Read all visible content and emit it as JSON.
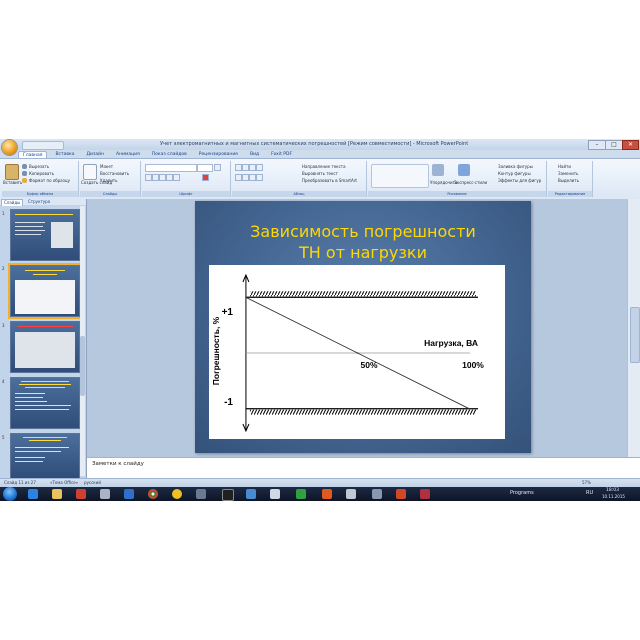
{
  "window": {
    "title": "Учет электромагнитных и магнитных систематических погрешностей [Режим совместимости] - Microsoft PowerPoint",
    "min": "–",
    "max": "□",
    "close": "✕"
  },
  "ribbon_tabs": [
    {
      "label": "Главная",
      "active": true
    },
    {
      "label": "Вставка",
      "active": false
    },
    {
      "label": "Дизайн",
      "active": false
    },
    {
      "label": "Анимация",
      "active": false
    },
    {
      "label": "Показ слайдов",
      "active": false
    },
    {
      "label": "Рецензирование",
      "active": false
    },
    {
      "label": "Вид",
      "active": false
    },
    {
      "label": "Foxit PDF",
      "active": false
    }
  ],
  "ribbon": {
    "clipboard": {
      "paste": "Вставить",
      "cut": "Вырезать",
      "copy": "Копировать",
      "format_painter": "Формат по образцу",
      "group": "Буфер обмена"
    },
    "slides": {
      "new_slide": "Создать слайд",
      "layout": "Макет",
      "reset": "Восстановить",
      "delete": "Удалить",
      "group": "Слайды"
    },
    "font": {
      "group": "Шрифт"
    },
    "paragraph": {
      "direction": "Направление текста",
      "align": "Выровнять текст",
      "smartart": "Преобразовать в SmartArt",
      "group": "Абзац"
    },
    "drawing": {
      "arrange": "Упорядочить",
      "quick_styles": "Экспресс-стили",
      "fill": "Заливка фигуры",
      "outline": "Контур фигуры",
      "effects": "Эффекты для фигур",
      "group": "Рисование"
    },
    "editing": {
      "find": "Найти",
      "replace": "Заменить",
      "select": "Выделить",
      "group": "Редактирование"
    }
  },
  "panel": {
    "tabs": [
      "Слайды",
      "Структура"
    ],
    "slides": [
      {
        "num": "1",
        "title": "Трансформаторы напряжения"
      },
      {
        "num": "2",
        "title": "Зависимость погрешности ТН от нагрузки"
      },
      {
        "num": "3",
        "title": "Измерения мощности"
      },
      {
        "num": "4",
        "title": ""
      },
      {
        "num": "5",
        "title": ""
      }
    ]
  },
  "slide": {
    "title_line1": "Зависимость погрешности",
    "title_line2": "ТН от нагрузки"
  },
  "chart_data": {
    "type": "line",
    "title": "Зависимость погрешности ТН от нагрузки",
    "xlabel": "Нагрузка, ВА",
    "ylabel": "Погрешность, %",
    "ytick_labels": [
      "+1",
      "-1"
    ],
    "xtick_labels": [
      "50%",
      "100%"
    ],
    "x": [
      0,
      50,
      100
    ],
    "series": [
      {
        "values": [
          1,
          0,
          -1
        ]
      }
    ],
    "ylim": [
      -1.4,
      1.4
    ],
    "xlim": [
      -4,
      104
    ],
    "grid": false
  },
  "notes": {
    "text": "Заметки к слайду"
  },
  "statusbar": {
    "slide": "Слайд 11 из 27",
    "theme": "«Тема Office»",
    "lang": "русский",
    "zoom": "57%"
  },
  "taskbar": {
    "programs": "Programs",
    "lang": "RU",
    "time": "18:03",
    "date": "10.11.2015"
  }
}
